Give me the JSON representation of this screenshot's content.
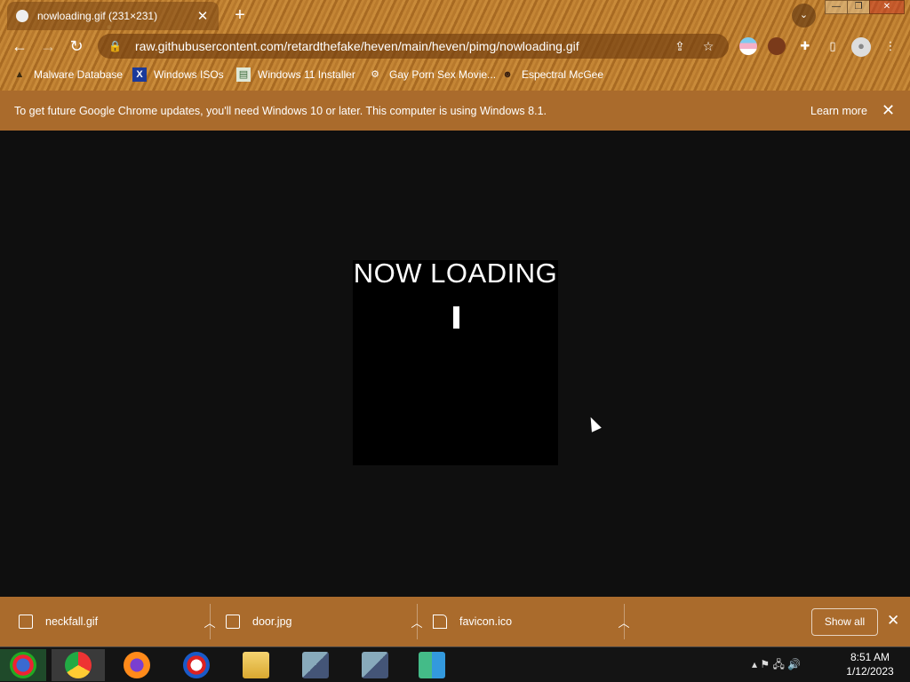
{
  "tab": {
    "title": "nowloading.gif (231×231)",
    "close": "✕"
  },
  "newtab": "+",
  "window": {
    "minimize": "—",
    "restore": "❐",
    "close": "✕",
    "tabsearch": "⌄"
  },
  "nav": {
    "back": "←",
    "forward": "→",
    "reload": "↻"
  },
  "omnibox": {
    "url": "raw.githubusercontent.com/retardthefake/heven/main/heven/pimg/nowloading.gif",
    "lock": "🔒",
    "share": "⇪",
    "star": "☆"
  },
  "extensions": {
    "puzzle": "✚",
    "sidepanel": "▯",
    "profile": "●",
    "menu": "⋮"
  },
  "bookmarks": [
    {
      "label": "Malware Database",
      "icon": "▲"
    },
    {
      "label": "Windows ISOs",
      "icon": "X"
    },
    {
      "label": "Windows 11 Installer",
      "icon": "▤"
    },
    {
      "label": "Gay Porn Sex Movie...",
      "icon": "⚙"
    },
    {
      "label": "Espectral McGee",
      "icon": "☻"
    }
  ],
  "infobar": {
    "message": "To get future Google Chrome updates, you'll need Windows 10 or later. This computer is using Windows 8.1.",
    "learn_more": "Learn more",
    "close": "✕"
  },
  "gif": {
    "text": "NOW LOADING"
  },
  "downloads": [
    {
      "name": "neckfall.gif",
      "chevron": "︿"
    },
    {
      "name": "door.jpg",
      "chevron": "︿"
    },
    {
      "name": "favicon.ico",
      "chevron": "︿"
    }
  ],
  "shelf": {
    "show_all": "Show all",
    "close": "✕"
  },
  "tray": {
    "items": "▴  ⚑  🖧  🔊"
  },
  "clock": {
    "time": "8:51 AM",
    "date": "1/12/2023"
  },
  "colors": {
    "chrome_theme": "#b8792c",
    "infobar": "#aa6b2c",
    "page_bg": "#0f0f0f"
  }
}
